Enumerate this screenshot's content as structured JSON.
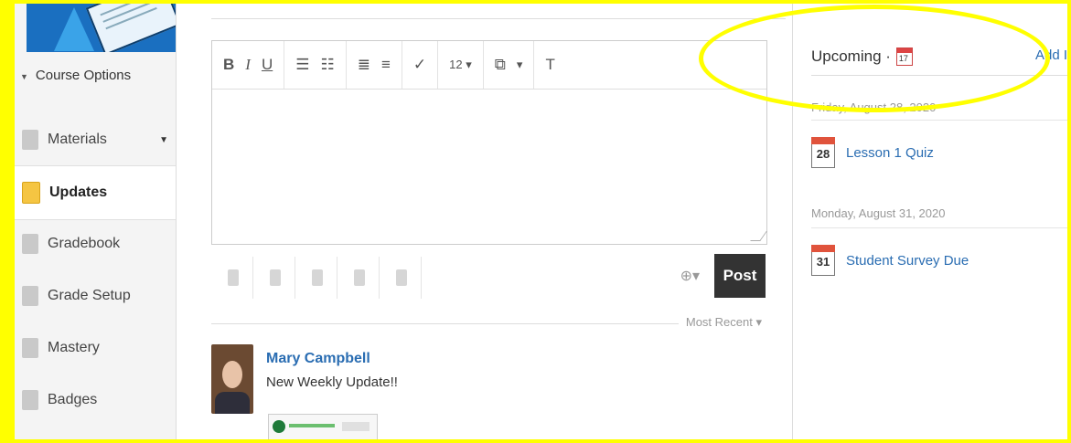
{
  "sidebar": {
    "course_options": "Course Options",
    "items": [
      {
        "label": "Materials",
        "icon": "materials-icon",
        "has_dropdown": true
      },
      {
        "label": "Updates",
        "icon": "updates-icon",
        "active": true
      },
      {
        "label": "Gradebook",
        "icon": "gradebook-icon"
      },
      {
        "label": "Grade Setup",
        "icon": "grade-setup-icon"
      },
      {
        "label": "Mastery",
        "icon": "mastery-icon"
      },
      {
        "label": "Badges",
        "icon": "badges-icon"
      }
    ]
  },
  "editor": {
    "toolbar": {
      "bold": "B",
      "italic": "I",
      "underline": "U",
      "font_size": "12 ▾",
      "insert": "▾",
      "clear": "T"
    },
    "post_label": "Post"
  },
  "feed": {
    "sort_label": "Most Recent ▾",
    "post": {
      "author": "Mary Campbell",
      "text": "New Weekly Update!!"
    }
  },
  "upcoming": {
    "title": "Upcoming ·",
    "calendar_day": "17",
    "add_label": "Add I",
    "groups": [
      {
        "date": "Friday, August 28, 2020",
        "events": [
          {
            "day": "28",
            "title": "Lesson 1 Quiz"
          }
        ]
      },
      {
        "date": "Monday, August 31, 2020",
        "events": [
          {
            "day": "31",
            "title": "Student Survey Due"
          }
        ]
      }
    ]
  },
  "colors": {
    "highlight": "#ffff00",
    "link": "#2a6db2",
    "post_button": "#333333"
  }
}
